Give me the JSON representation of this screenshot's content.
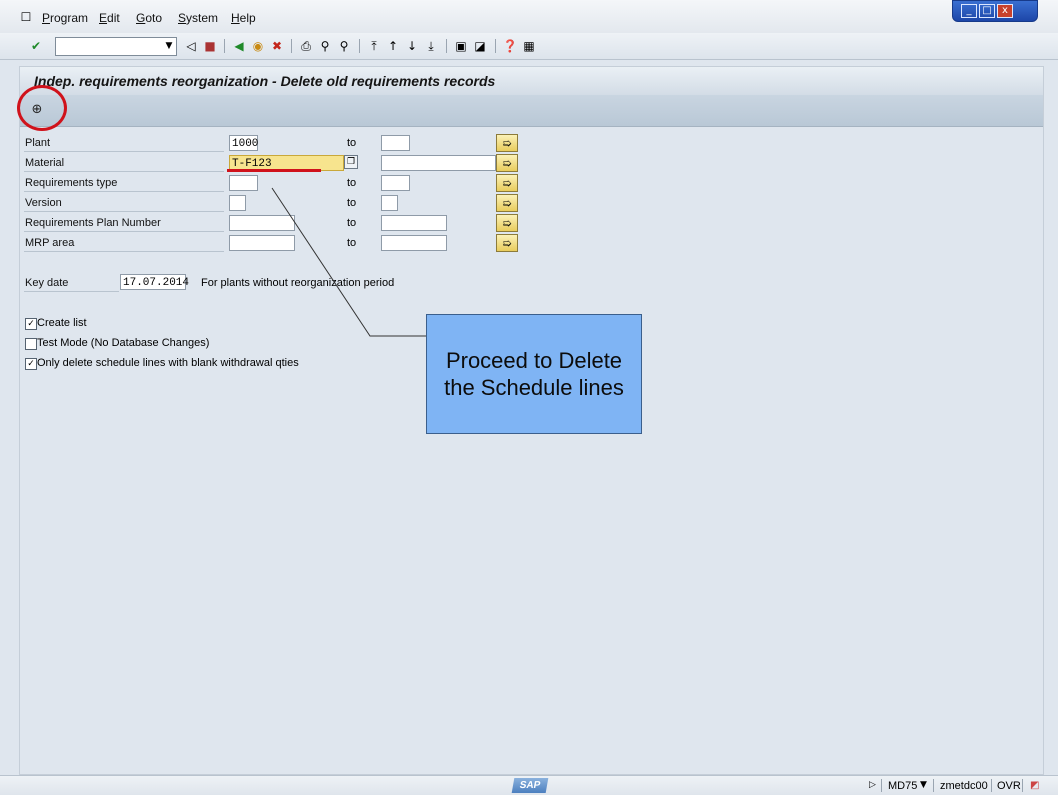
{
  "menu": {
    "items": [
      {
        "hot": "P",
        "rest": "rogram"
      },
      {
        "hot": "E",
        "rest": "dit"
      },
      {
        "hot": "G",
        "rest": "oto"
      },
      {
        "hot": "S",
        "rest": "ystem"
      },
      {
        "hot": "H",
        "rest": "elp"
      }
    ]
  },
  "window_controls": {
    "min": "_",
    "max": "□",
    "close": "x"
  },
  "toolbar": {
    "command_value": ""
  },
  "screen": {
    "title": "Indep. requirements reorganization - Delete old requirements records"
  },
  "form": {
    "to_label": "to",
    "rows": [
      {
        "label": "Plant",
        "from": "1000",
        "to": ""
      },
      {
        "label": "Material",
        "from": "T-F123",
        "to": ""
      },
      {
        "label": "Requirements type",
        "from": "",
        "to": ""
      },
      {
        "label": "Version",
        "from": "",
        "to": ""
      },
      {
        "label": "Requirements Plan Number",
        "from": "",
        "to": ""
      },
      {
        "label": "MRP area",
        "from": "",
        "to": ""
      }
    ],
    "key_date_label": "Key date",
    "key_date_value": "17.07.2014",
    "key_date_note": "For plants without reorganization period",
    "checkboxes": [
      {
        "label": "Create list",
        "checked": true
      },
      {
        "label": "Test Mode (No Database Changes)",
        "checked": false
      },
      {
        "label": "Only delete schedule lines with blank withdrawal qties",
        "checked": true
      }
    ]
  },
  "callout": {
    "line1": "Proceed to Delete",
    "line2": "the Schedule lines"
  },
  "status": {
    "logo": "SAP",
    "transaction": "MD75",
    "server": "zmetdc00",
    "mode": "OVR"
  },
  "colors": {
    "callout": "#7fb4f4",
    "highlight": "#f7e48e",
    "annotation": "#d0121b"
  }
}
